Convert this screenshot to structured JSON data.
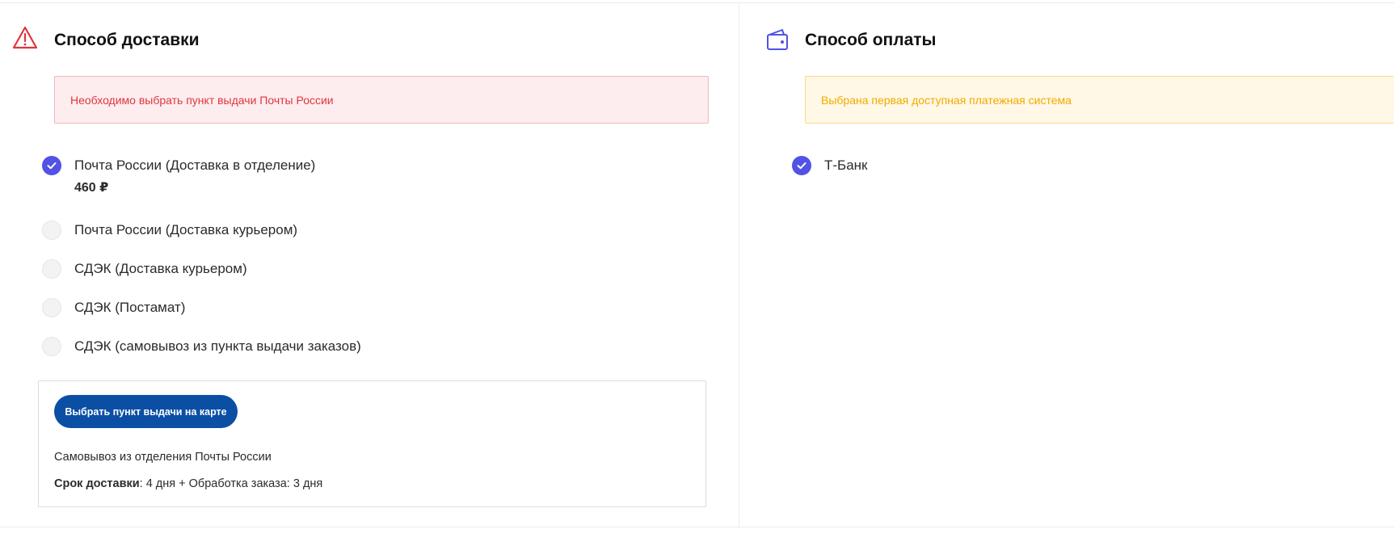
{
  "delivery": {
    "title": "Способ доставки",
    "alert": "Необходимо выбрать пункт выдачи Почты России",
    "options": [
      {
        "label": "Почта России (Доставка в отделение)",
        "price": "460 ₽",
        "selected": true
      },
      {
        "label": "Почта России (Доставка курьером)",
        "selected": false
      },
      {
        "label": "СДЭК (Доставка курьером)",
        "selected": false
      },
      {
        "label": "СДЭК (Постамат)",
        "selected": false
      },
      {
        "label": "СДЭК (самовывоз из пункта выдачи заказов)",
        "selected": false
      }
    ],
    "map_button": "Выбрать пункт выдачи на карте",
    "pickup_text": "Самовывоз из отделения Почты России",
    "term_label": "Срок доставки",
    "term_value": ": 4 дня + Обработка заказа: 3 дня"
  },
  "payment": {
    "title": "Способ оплаты",
    "alert": "Выбрана первая доступная платежная система",
    "options": [
      {
        "label": "Т-Банк",
        "selected": true
      }
    ]
  },
  "colors": {
    "accent": "#5252e6",
    "error": "#e0353f",
    "warning": "#f2a900",
    "button": "#0b4fa5"
  },
  "icons": {
    "delivery_header": "warning-triangle-icon",
    "payment_header": "wallet-icon",
    "selected": "check-icon"
  }
}
